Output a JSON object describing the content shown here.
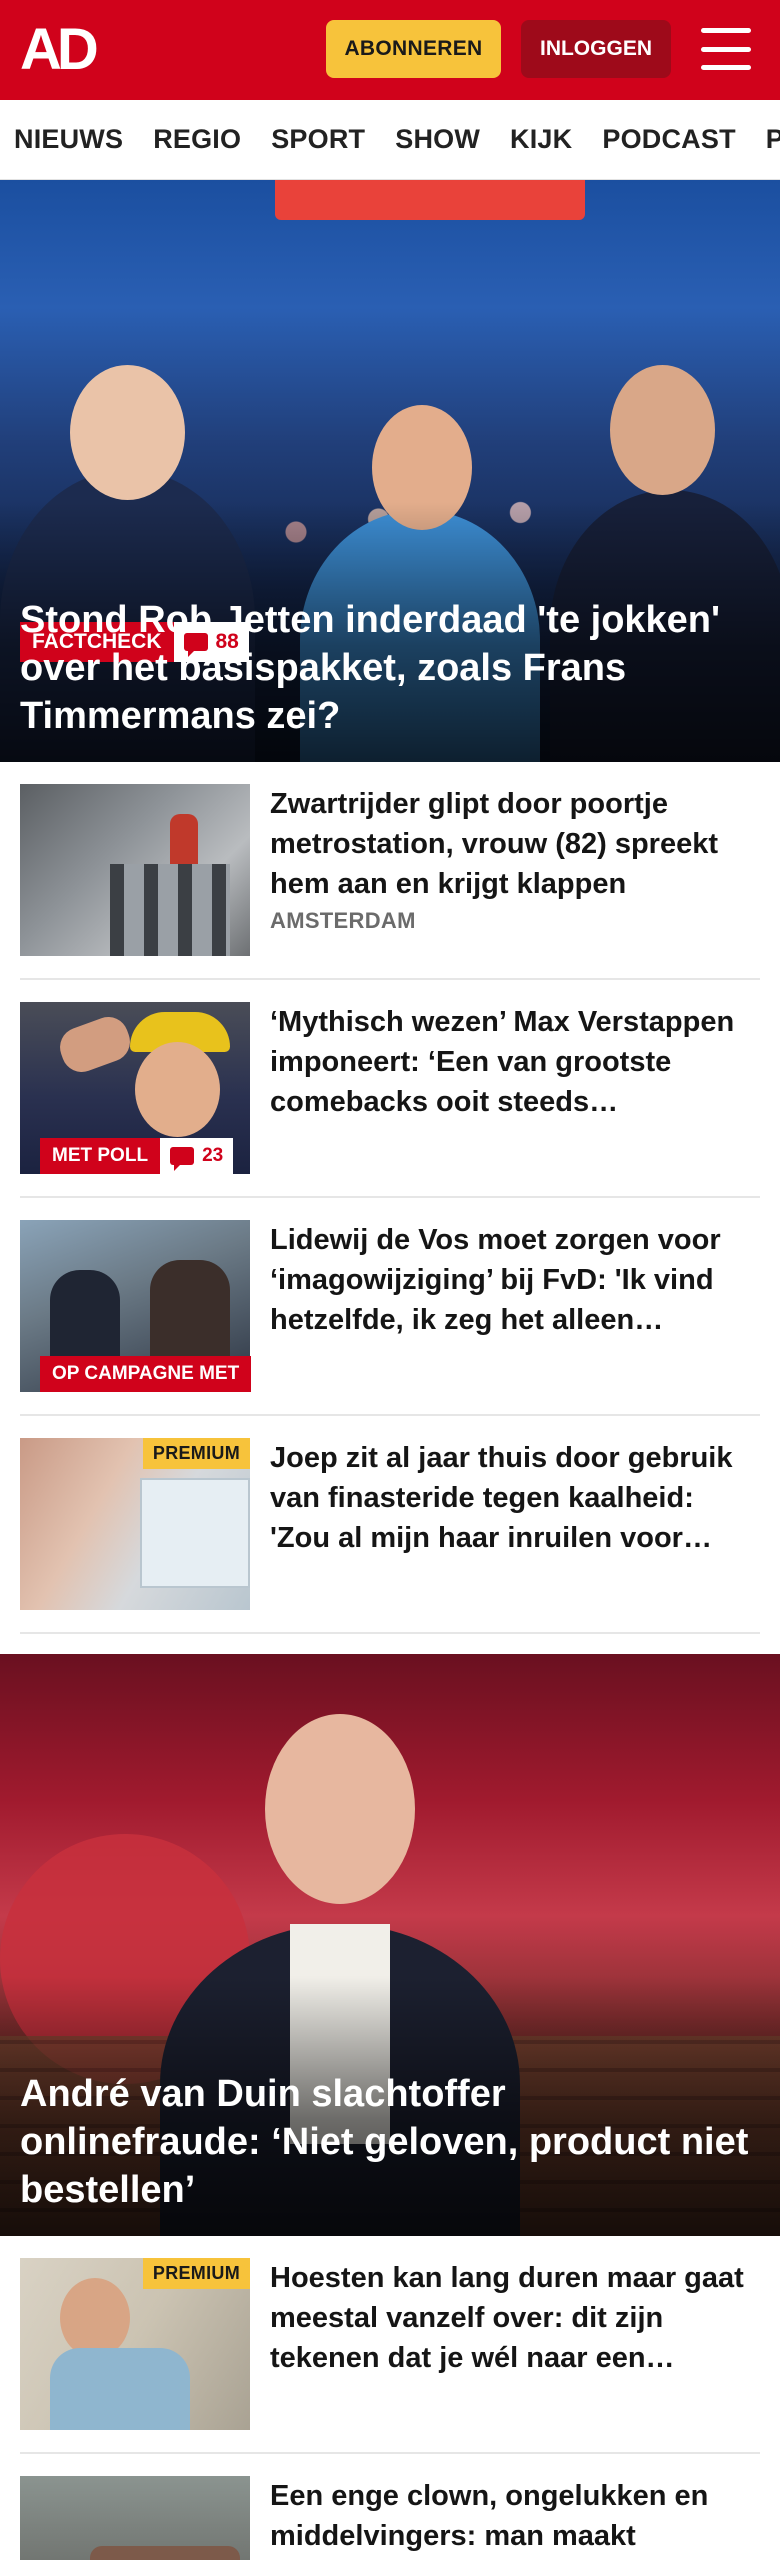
{
  "header": {
    "logo": "AD",
    "subscribe_label": "ABONNEREN",
    "login_label": "INLOGGEN"
  },
  "nav": {
    "items": [
      "NIEUWS",
      "REGIO",
      "SPORT",
      "SHOW",
      "KIJK",
      "PODCAST",
      "PUZZ"
    ]
  },
  "hero1": {
    "tag": "FACTCHECK",
    "comments": "88",
    "title": "Stond Rob Jetten inderdaad 'te jokken' over het basispakket, zoals Frans Timmermans zei?"
  },
  "articles1": [
    {
      "title": "Zwartrijder glipt door poortje metrostation, vrouw (82) spreekt hem aan en krijgt klappen",
      "kicker": "AMSTERDAM"
    },
    {
      "title": "‘Mythisch wezen’ Max Verstappen imponeert: ‘Een van grootste comebacks ooit steeds…",
      "tag": "MET POLL",
      "comments": "23"
    },
    {
      "title": "Lidewij de Vos moet zorgen voor ‘imagowijziging’ bij FvD: 'Ik vind hetzelfde, ik zeg het alleen…",
      "tag": "OP CAMPAGNE MET"
    },
    {
      "title": "Joep zit al jaar thuis door gebruik van finasteride tegen kaalheid: 'Zou al mijn haar inruilen voor…",
      "badge": "PREMIUM"
    }
  ],
  "hero2": {
    "title": "André van Duin slachtoffer onlinefraude: ‘Niet geloven, product niet bestellen’"
  },
  "articles2": [
    {
      "title": "Hoesten kan lang duren maar gaat meestal vanzelf over: dit zijn tekenen dat je wél naar een…",
      "badge": "PREMIUM"
    },
    {
      "title": "Een enge clown, ongelukken en middelvingers: man maakt tentoonstelling met foto’s van…"
    }
  ]
}
